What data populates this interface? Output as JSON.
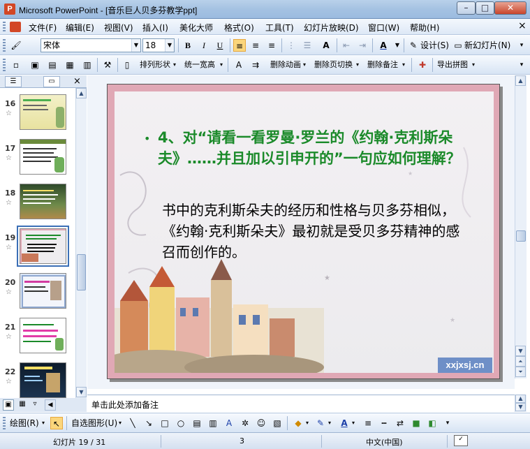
{
  "window": {
    "title": "Microsoft PowerPoint - [音乐巨人贝多芬教学ppt]",
    "app_icon_letter": "P",
    "minimize": "–",
    "restore": "□",
    "close": "✕"
  },
  "menu": {
    "items": [
      "文件(F)",
      "编辑(E)",
      "视图(V)",
      "插入(I)",
      "美化大师",
      "格式(O)",
      "工具(T)",
      "幻灯片放映(D)",
      "窗口(W)",
      "帮助(H)"
    ],
    "close_doc": "×"
  },
  "format_toolbar": {
    "font_name": "宋体",
    "font_size": "18",
    "bold": "B",
    "italic": "I",
    "underline": "U",
    "design_label": "设计(S)",
    "new_slide_label": "新幻灯片(N)"
  },
  "beautify_toolbar": {
    "arrange_label": "排列形状",
    "uniform_width_label": "统一宽高",
    "delete_animation_label": "删除动画",
    "delete_transition_label": "删除页切换",
    "delete_notes_label": "删除备注",
    "export_label": "导出拼图"
  },
  "thumbnails": [
    {
      "number": "16"
    },
    {
      "number": "17"
    },
    {
      "number": "18"
    },
    {
      "number": "19",
      "selected": true
    },
    {
      "number": "20"
    },
    {
      "number": "21"
    },
    {
      "number": "22"
    }
  ],
  "slide": {
    "bullet": "•",
    "question": "4、对“请看一看罗曼·罗兰的《约翰·克利斯朵夫》……并且加以引申开的”一句应如何理解？",
    "answer": "书中的克利斯朵夫的经历和性格与贝多芬相似，《约翰·克利斯朵夫》最初就是受贝多芬精神的感召而创作的。",
    "watermark": "xxjxsj.cn",
    "frame_color": "#e0a8b5",
    "question_color": "#1b8a2a"
  },
  "notes": {
    "placeholder": "单击此处添加备注"
  },
  "draw_toolbar": {
    "draw_label": "绘图(R)",
    "autoshapes_label": "自选图形(U)"
  },
  "status": {
    "slide_info": "幻灯片 19 / 31",
    "design": "3",
    "language": "中文(中国)"
  }
}
